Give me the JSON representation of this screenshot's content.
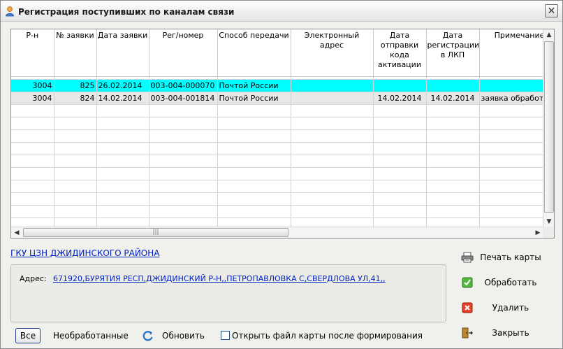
{
  "window": {
    "title": "Регистрация поступивших по каналам связи",
    "close_label": "✕"
  },
  "grid": {
    "columns": [
      "Р-н",
      "№ заявки",
      "Дата заявки",
      "Рег/номер",
      "Способ передачи",
      "Электронный адрес",
      "Дата отправки кода активации",
      "Дата регистрации в ЛКП",
      "Примечание"
    ],
    "rows": [
      [
        "3004",
        "825",
        "26.02.2014",
        "003-004-000070",
        "Почтой России",
        "",
        "",
        "",
        ""
      ],
      [
        "3004",
        "824",
        "14.02.2014",
        "003-004-001814",
        "Почтой России",
        "",
        "14.02.2014",
        "14.02.2014",
        "заявка обработана"
      ]
    ],
    "selected_row": 0,
    "empty_rows": 10,
    "hscroll_grip": "|||"
  },
  "org_link": "ГКУ ЦЗН ДЖИДИНСКОГО РАЙОНА",
  "address": {
    "label": "Адрес:",
    "value": "671920,БУРЯТИЯ РЕСП,ДЖИДИНСКИЙ Р-Н,,ПЕТРОПАВЛОВКА С,СВЕРДЛОВА УЛ,41,,"
  },
  "side_buttons": {
    "print": "Печать карты",
    "process": "Обработать",
    "delete": "Удалить",
    "close": "Закрыть"
  },
  "bottom": {
    "all": "Все",
    "unprocessed": "Необработанные",
    "refresh": "Обновить",
    "open_file": "Открыть файл карты  после формирования",
    "open_file_checked": false
  },
  "colors": {
    "selected_row": "#00ffff",
    "link": "#0020c0"
  }
}
